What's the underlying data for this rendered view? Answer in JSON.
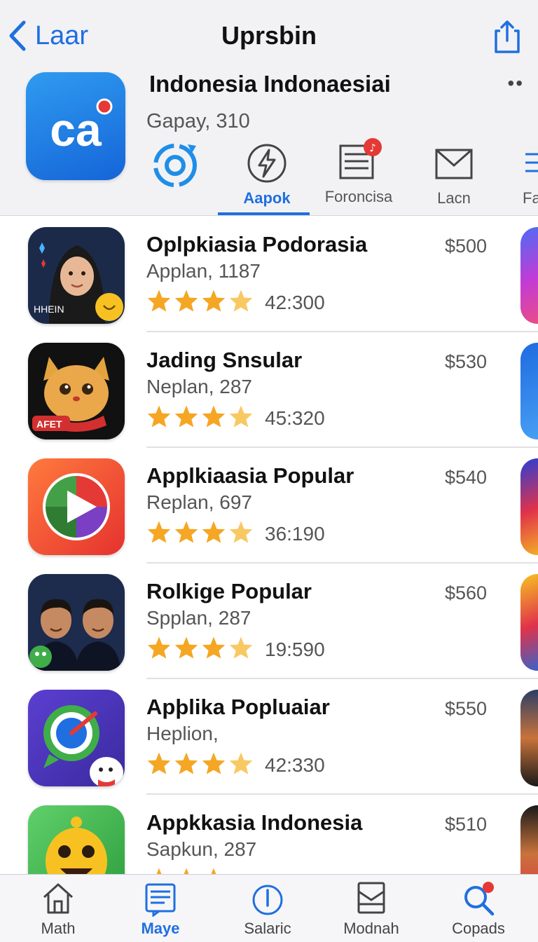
{
  "nav": {
    "back_label": "Laar",
    "title": "Uprsbin"
  },
  "app": {
    "name": "Indonesia Indonaesiai",
    "meta": "Gapay, 310",
    "icon_text": "ca",
    "more": "••"
  },
  "tabs": [
    {
      "label": "",
      "icon": "refresh-gear-icon"
    },
    {
      "label": "Aapok",
      "icon": "lightning-icon",
      "active": true
    },
    {
      "label": "Foroncisa",
      "icon": "news-icon"
    },
    {
      "label": "Lacn",
      "icon": "mail-icon"
    },
    {
      "label": "Fa",
      "icon": "list-icon"
    }
  ],
  "apps": [
    {
      "name": "Oplpkiasia Podorasia",
      "sub": "Applan, 1187",
      "rating": "42:300",
      "price": "$500",
      "badge": "HHEIN"
    },
    {
      "name": "Jading Snsular",
      "sub": "Neplan, 287",
      "rating": "45:320",
      "price": "$530",
      "badge": "AFET"
    },
    {
      "name": "Applkiaasia Popular",
      "sub": "Replan, 697",
      "rating": "36:190",
      "price": "$540"
    },
    {
      "name": "Rolkige Popular",
      "sub": "Spplan, 287",
      "rating": "19:590",
      "price": "$560"
    },
    {
      "name": "Apþlika Popluaiar",
      "sub": "Heplion,",
      "rating": "42:330",
      "price": "$550"
    },
    {
      "name": "Appkkasia Indonesia",
      "sub": "Sapkun, 287",
      "rating": "",
      "price": "$510"
    }
  ],
  "bottom_tabs": [
    {
      "label": "Math",
      "icon": "home-icon"
    },
    {
      "label": "Maye",
      "icon": "news-icon",
      "active": true
    },
    {
      "label": "Salaric",
      "icon": "info-icon"
    },
    {
      "label": "Modnah",
      "icon": "inbox-icon"
    },
    {
      "label": "Copads",
      "icon": "search-icon"
    }
  ],
  "colors": {
    "accent": "#1f6fe0",
    "star": "#f5a623",
    "badge_red": "#e53935"
  }
}
